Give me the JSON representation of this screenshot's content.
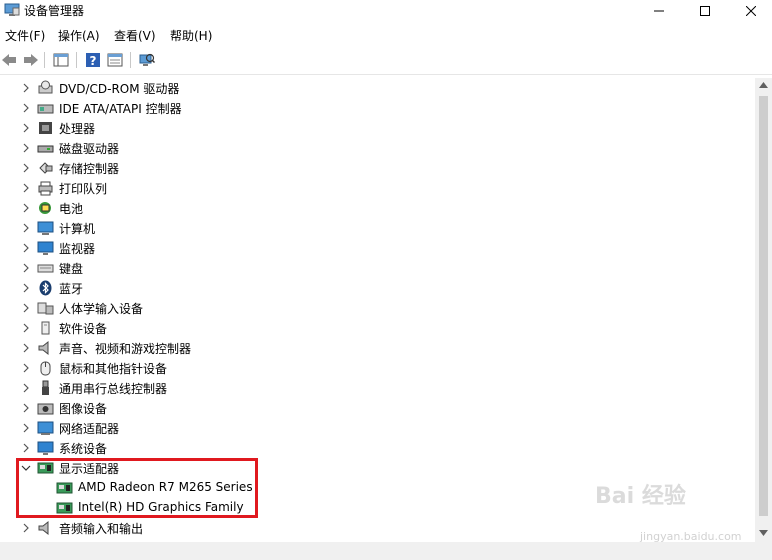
{
  "window": {
    "title": "设备管理器"
  },
  "menu": [
    "文件(F)",
    "操作(A)",
    "查看(V)",
    "帮助(H)"
  ],
  "tree": [
    {
      "label": "DVD/CD-ROM 驱动器",
      "icon": "dvd-drive-icon",
      "expanded": false
    },
    {
      "label": "IDE ATA/ATAPI 控制器",
      "icon": "ide-controller-icon",
      "expanded": false
    },
    {
      "label": "处理器",
      "icon": "processor-icon",
      "expanded": false
    },
    {
      "label": "磁盘驱动器",
      "icon": "disk-drive-icon",
      "expanded": false
    },
    {
      "label": "存储控制器",
      "icon": "storage-controller-icon",
      "expanded": false
    },
    {
      "label": "打印队列",
      "icon": "printer-icon",
      "expanded": false
    },
    {
      "label": "电池",
      "icon": "battery-icon",
      "expanded": false
    },
    {
      "label": "计算机",
      "icon": "computer-icon",
      "expanded": false
    },
    {
      "label": "监视器",
      "icon": "monitor-icon",
      "expanded": false
    },
    {
      "label": "键盘",
      "icon": "keyboard-icon",
      "expanded": false
    },
    {
      "label": "蓝牙",
      "icon": "bluetooth-icon",
      "expanded": false
    },
    {
      "label": "人体学输入设备",
      "icon": "hid-icon",
      "expanded": false
    },
    {
      "label": "软件设备",
      "icon": "software-device-icon",
      "expanded": false
    },
    {
      "label": "声音、视频和游戏控制器",
      "icon": "sound-icon",
      "expanded": false
    },
    {
      "label": "鼠标和其他指针设备",
      "icon": "mouse-icon",
      "expanded": false
    },
    {
      "label": "通用串行总线控制器",
      "icon": "usb-icon",
      "expanded": false
    },
    {
      "label": "图像设备",
      "icon": "camera-icon",
      "expanded": false
    },
    {
      "label": "网络适配器",
      "icon": "network-adapter-icon",
      "expanded": false
    },
    {
      "label": "系统设备",
      "icon": "system-device-icon",
      "expanded": false
    },
    {
      "label": "显示适配器",
      "icon": "display-adapter-icon",
      "expanded": true,
      "children": [
        {
          "label": "AMD Radeon R7 M265 Series",
          "icon": "display-adapter-icon"
        },
        {
          "label": "Intel(R) HD Graphics Family",
          "icon": "display-adapter-icon"
        }
      ]
    },
    {
      "label": "音频输入和输出",
      "icon": "audio-io-icon",
      "expanded": false
    }
  ],
  "watermark": {
    "text": "Bai 经验",
    "url": "jingyan.baidu.com"
  },
  "colors": {
    "highlight": "#e0191f",
    "accent": "#1e73c8"
  }
}
